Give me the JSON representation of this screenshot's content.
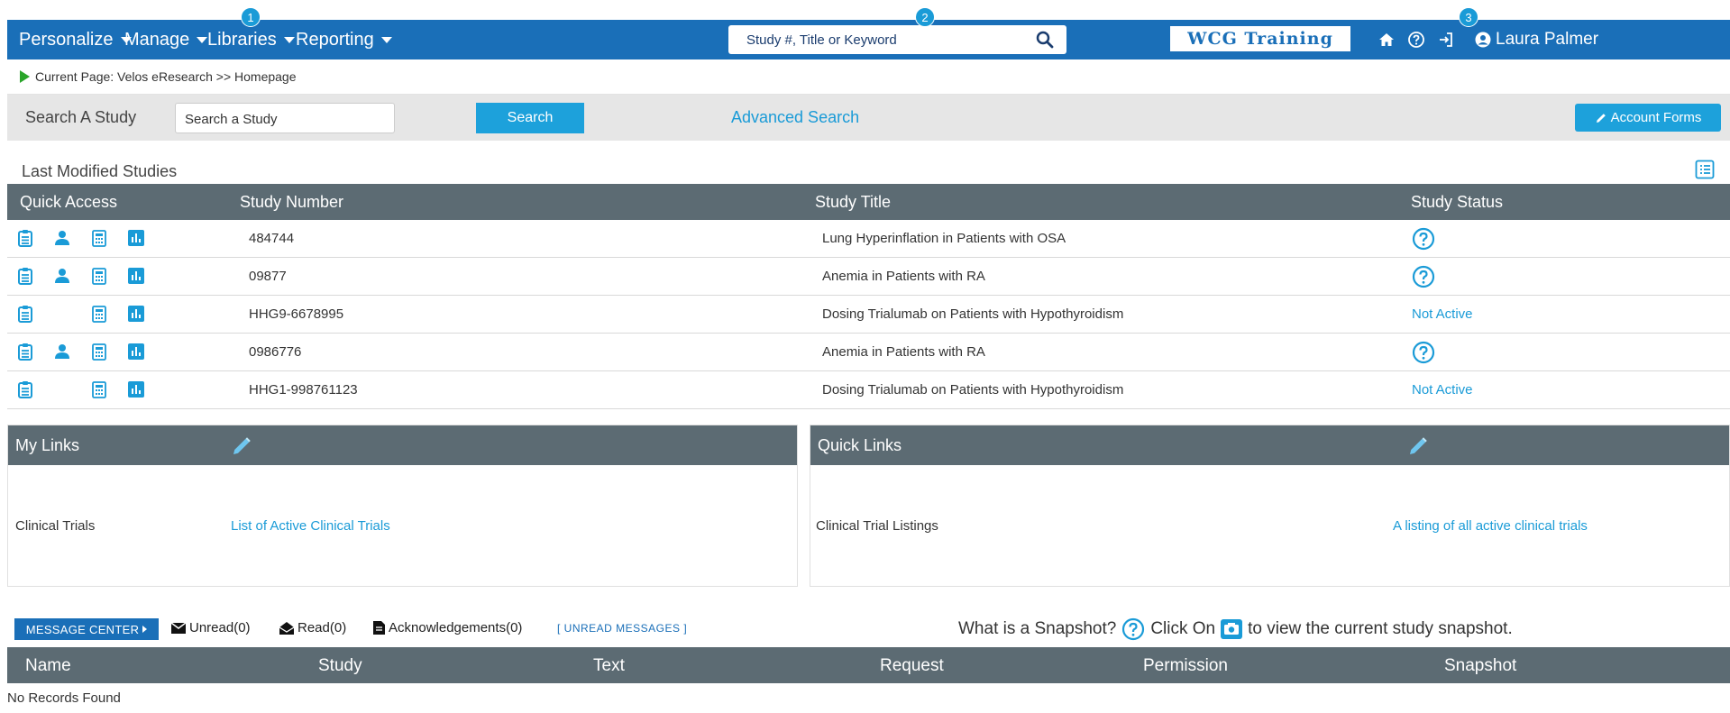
{
  "nav": {
    "menus": [
      {
        "label": "Personalize"
      },
      {
        "label": "Manage"
      },
      {
        "label": "Libraries"
      },
      {
        "label": "Reporting"
      }
    ],
    "search_placeholder": "Study #, Title or Keyword",
    "brand": "WCG Training",
    "user_name": "Laura Palmer",
    "badges": [
      "1",
      "2",
      "3"
    ],
    "icons": [
      "home-icon",
      "help-icon",
      "logout-icon",
      "user-circle-icon"
    ]
  },
  "breadcrumb": "Current Page: Velos eResearch >> Homepage",
  "study_search": {
    "label": "Search A Study",
    "placeholder": "Search a Study",
    "button": "Search",
    "advanced": "Advanced Search",
    "account_forms": "Account Forms"
  },
  "last_modified": {
    "title": "Last Modified Studies",
    "columns": [
      "Quick Access",
      "Study Number",
      "Study Title",
      "Study Status"
    ],
    "rows": [
      {
        "number": "484744",
        "title": "Lung Hyperinflation in Patients with OSA",
        "status": "",
        "status_icon": "help-icon",
        "has_patient_icon": true
      },
      {
        "number": "09877",
        "title": "Anemia in Patients with RA",
        "status": "",
        "status_icon": "help-icon",
        "has_patient_icon": true
      },
      {
        "number": "HHG9-6678995",
        "title": "Dosing Trialumab on Patients with Hypothyroidism",
        "status": "Not Active",
        "status_icon": "",
        "has_patient_icon": false
      },
      {
        "number": "0986776",
        "title": "Anemia in Patients with RA",
        "status": "",
        "status_icon": "help-icon",
        "has_patient_icon": true
      },
      {
        "number": "HHG1-998761123",
        "title": "Dosing Trialumab on Patients with Hypothyroidism",
        "status": "Not Active",
        "status_icon": "",
        "has_patient_icon": false
      }
    ]
  },
  "my_links": {
    "title": "My Links",
    "name": "Clinical Trials",
    "link": "List of Active Clinical Trials"
  },
  "quick_links": {
    "title": "Quick Links",
    "name": "Clinical Trial Listings",
    "link": "A listing of all active clinical trials"
  },
  "message_center": {
    "button": "MESSAGE CENTER",
    "unread": "Unread(0)",
    "read": "Read(0)",
    "acks": "Acknowledgements(0)",
    "unread_link": "[ UNREAD MESSAGES ]",
    "snap_q": "What is a Snapshot?",
    "snap_click": "Click On",
    "snap_rest": "to view the current study snapshot.",
    "columns": [
      "Name",
      "Study",
      "Text",
      "Request",
      "Permission",
      "Snapshot"
    ],
    "empty": "No Records Found"
  },
  "colors": {
    "nav_blue": "#1a6fb8",
    "accent_blue": "#1da1db",
    "header_gray": "#5c6b73",
    "status_green": "#2aa52a"
  }
}
